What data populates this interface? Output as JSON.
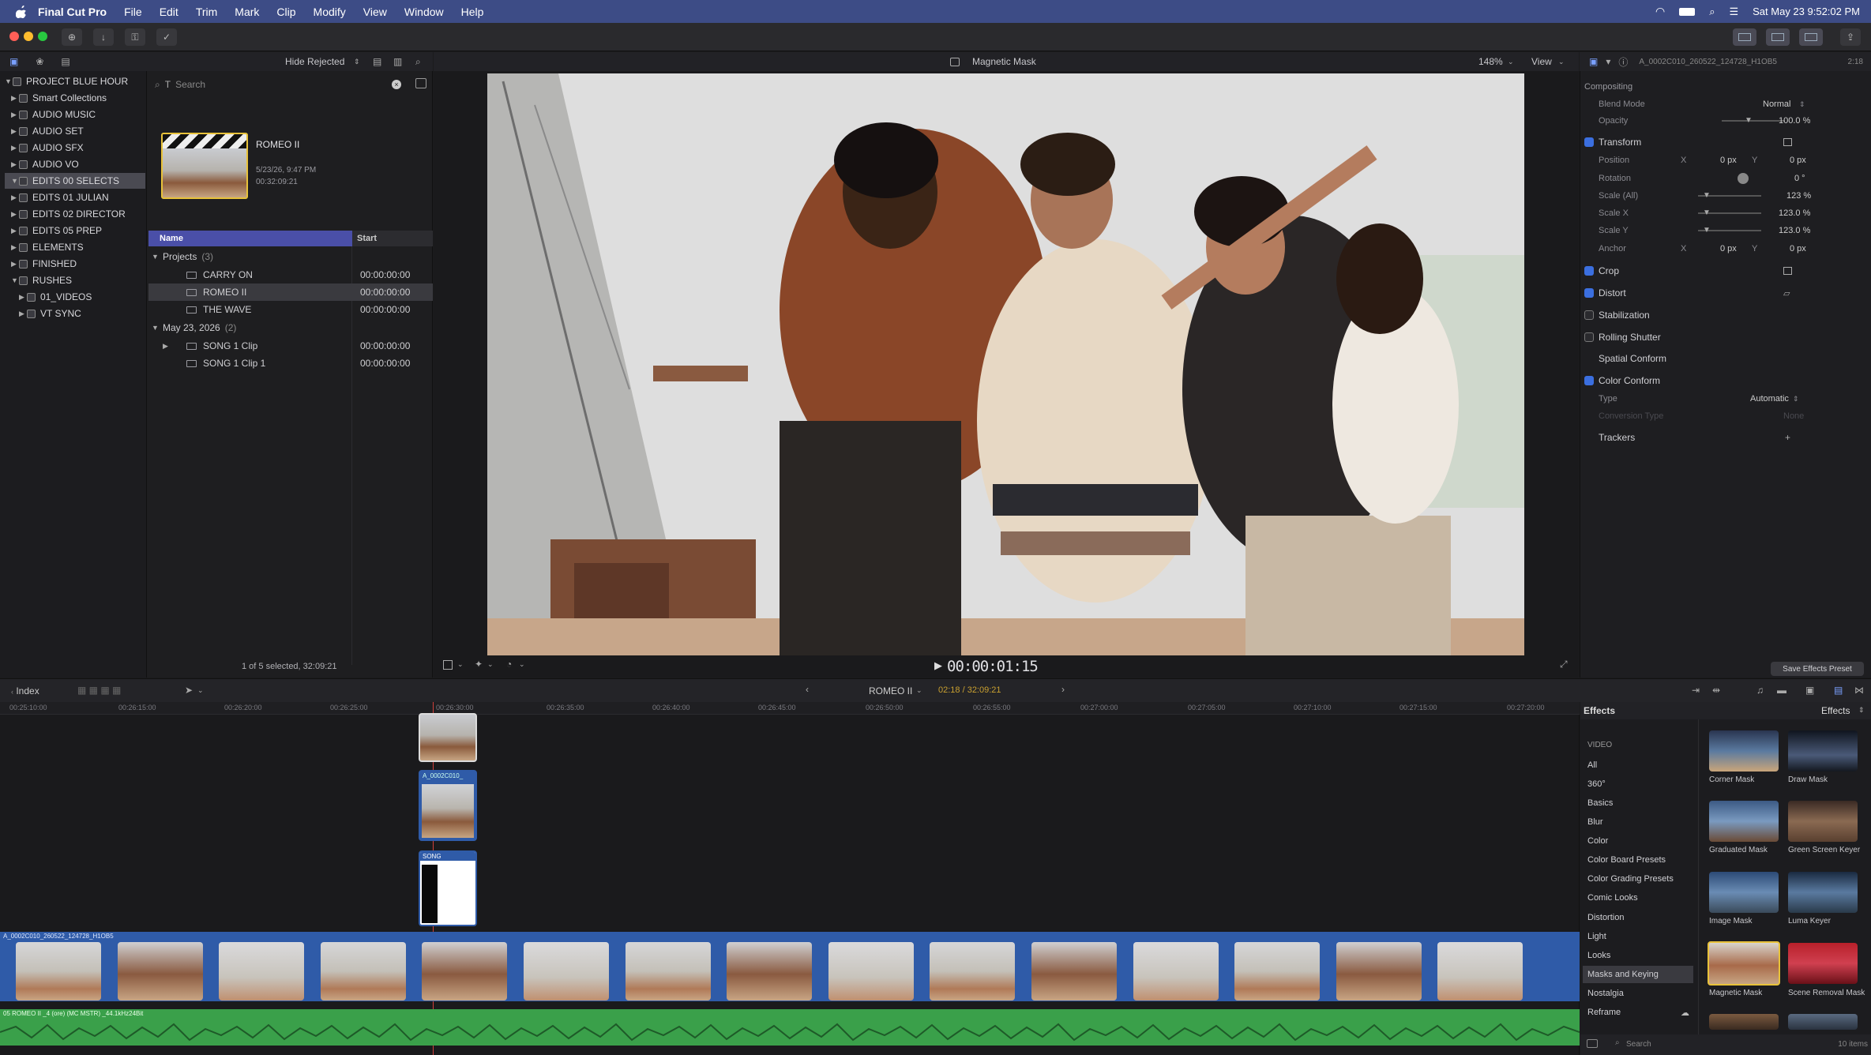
{
  "menubar": {
    "app": "Final Cut Pro",
    "items": [
      "File",
      "Edit",
      "Trim",
      "Mark",
      "Clip",
      "Modify",
      "View",
      "Window",
      "Help"
    ],
    "clock": "Sat May 23  9:52:02 PM"
  },
  "browser": {
    "filter": "Hide Rejected",
    "search_placeholder": "Search",
    "status": "1 of 5 selected, 32:09:21",
    "thumb": {
      "name": "ROMEO II",
      "date": "5/23/26, 9:47 PM",
      "duration": "00:32:09:21"
    },
    "columns": {
      "name": "Name",
      "start": "Start"
    },
    "groups": [
      {
        "label": "Projects",
        "count": "(3)"
      },
      {
        "label": "May 23, 2026",
        "count": "(2)"
      }
    ],
    "rows": [
      {
        "name": "CARRY ON",
        "start": "00:00:00:00"
      },
      {
        "name": "ROMEO II",
        "start": "00:00:00:00"
      },
      {
        "name": "THE WAVE",
        "start": "00:00:00:00"
      },
      {
        "name": "SONG 1 Clip",
        "start": "00:00:00:00"
      },
      {
        "name": "SONG 1 Clip 1",
        "start": "00:00:00:00"
      }
    ]
  },
  "library": {
    "items": [
      "PROJECT BLUE HOUR",
      "Smart Collections",
      "AUDIO MUSIC",
      "AUDIO SET",
      "AUDIO SFX",
      "AUDIO VO",
      "EDITS 00 SELECTS",
      "EDITS 01 JULIAN",
      "EDITS 02 DIRECTOR",
      "EDITS 05 PREP",
      "ELEMENTS",
      "FINISHED",
      "RUSHES",
      "01_VIDEOS",
      "VT SYNC"
    ]
  },
  "viewer": {
    "title": "Magnetic Mask",
    "zoom": "148%",
    "view": "View",
    "timecode": "00:00:01:15"
  },
  "inspector": {
    "clip_name": "A_0002C010_260522_124728_H1OB5",
    "duration": "2:18",
    "compositing": "Compositing",
    "blend_mode_label": "Blend Mode",
    "blend_mode": "Normal",
    "opacity_label": "Opacity",
    "opacity": "100.0 %",
    "transform": "Transform",
    "position_label": "Position",
    "position_x": "0 px",
    "position_y": "0 px",
    "rotation_label": "Rotation",
    "rotation": "0 °",
    "scale_all_label": "Scale (All)",
    "scale_all": "123 %",
    "scale_x_label": "Scale X",
    "scale_x": "123.0 %",
    "scale_y_label": "Scale Y",
    "scale_y": "123.0 %",
    "anchor_label": "Anchor",
    "anchor_x": "0 px",
    "anchor_y": "0 px",
    "x": "X",
    "y": "Y",
    "crop": "Crop",
    "distort": "Distort",
    "stabilization": "Stabilization",
    "rolling_shutter": "Rolling Shutter",
    "spatial_conform": "Spatial Conform",
    "color_conform": "Color Conform",
    "type_label": "Type",
    "type": "Automatic",
    "conversion_label": "Conversion Type",
    "conversion": "None",
    "trackers": "Trackers",
    "save_preset": "Save Effects Preset"
  },
  "timeline": {
    "index": "Index",
    "project": "ROMEO II",
    "position": "02:18 / 32:09:21",
    "ruler": [
      "00:25:10:00",
      "00:26:15:00",
      "00:26:20:00",
      "00:26:25:00",
      "00:26:30:00",
      "00:26:35:00",
      "00:26:40:00",
      "00:26:45:00",
      "00:26:50:00",
      "00:26:55:00",
      "00:27:00:00",
      "00:27:05:00",
      "00:27:10:00",
      "00:27:15:00",
      "00:27:20:00"
    ],
    "primary_clip": "A_0002C010_260522_124728_H1OB5",
    "audio_clip": "05 ROMEO II _4 (ore) (MC MSTR) _44.1kHz24Bit",
    "connected_labels": [
      "A_0002C010_",
      "SONG"
    ]
  },
  "effects": {
    "header": "Effects",
    "header2": "Effects",
    "categories": [
      "VIDEO",
      "All",
      "360°",
      "Basics",
      "Blur",
      "Color",
      "Color Board Presets",
      "Color Grading Presets",
      "Comic Looks",
      "Distortion",
      "Light",
      "Looks",
      "Masks and Keying",
      "Nostalgia",
      "Reframe"
    ],
    "thumbs": [
      "Corner Mask",
      "Draw Mask",
      "Graduated Mask",
      "Green Screen Keyer",
      "Image Mask",
      "Luma Keyer",
      "Magnetic Mask",
      "Scene Removal Mask"
    ],
    "search_placeholder": "Search",
    "count": "10 items"
  },
  "colors": {
    "menubar": "#3d4c86",
    "accent": "#3b6fe0",
    "audio": "#3aa04a",
    "clip_blue": "#2f5ba8"
  }
}
